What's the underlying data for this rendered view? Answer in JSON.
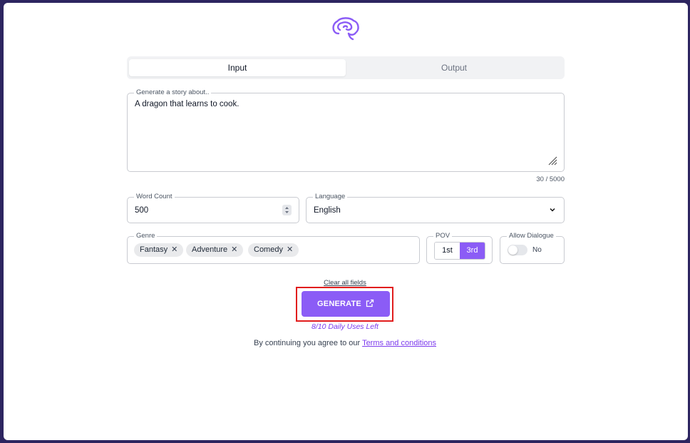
{
  "tabs": {
    "input": "Input",
    "output": "Output",
    "active": "Input"
  },
  "story": {
    "label": "Generate a story about..",
    "value": "A dragon that learns to cook.",
    "counter": "30 / 5000"
  },
  "word_count": {
    "label": "Word Count",
    "value": "500"
  },
  "language": {
    "label": "Language",
    "value": "English"
  },
  "genre": {
    "label": "Genre",
    "chips": [
      "Fantasy",
      "Adventure",
      "Comedy"
    ]
  },
  "pov": {
    "label": "POV",
    "options": [
      "1st",
      "3rd"
    ],
    "selected": "3rd"
  },
  "allow_dialogue": {
    "label": "Allow Dialogue",
    "state": "No"
  },
  "actions": {
    "clear_label": "Clear all fields",
    "generate_label": "GENERATE",
    "uses_left": "8/10 Daily Uses Left"
  },
  "terms": {
    "prefix": "By continuing you agree to our",
    "link": "Terms and conditions"
  },
  "colors": {
    "accent": "#8b5cf6",
    "background": "#2d2560",
    "highlight": "#e11d1d"
  }
}
